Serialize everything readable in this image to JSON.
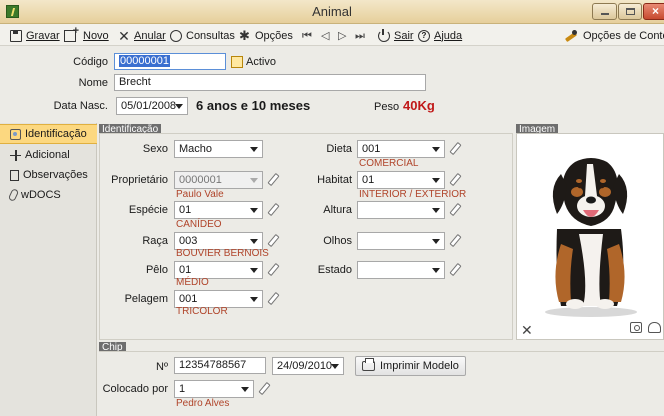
{
  "window": {
    "title": "Animal"
  },
  "toolbar": {
    "save": "Gravar",
    "new": "Novo",
    "cancel": "Anular",
    "queries": "Consultas",
    "options": "Opções",
    "exit": "Sair",
    "help": "Ajuda",
    "context_options": "Opções de Contexto",
    "nav_glyphs": {
      "first": "⏮",
      "prev": "◁",
      "next": "▷",
      "last": "⏭"
    }
  },
  "header": {
    "code_label": "Código",
    "code_value": "00000001",
    "active_label": "Activo",
    "name_label": "Nome",
    "name_value": "Brecht",
    "birth_label": "Data Nasc.",
    "birth_value": "05/01/2008",
    "age_text": "6 anos e 10 meses",
    "weight_label": "Peso",
    "weight_value": "40Kg",
    "weight_color": "#c01818"
  },
  "sidebar": {
    "items": [
      {
        "label": "Identificação",
        "icon": "id-card-icon",
        "active": true
      },
      {
        "label": "Adicional",
        "icon": "plus-icon",
        "active": false
      },
      {
        "label": "Observações",
        "icon": "document-icon",
        "active": false
      },
      {
        "label": "wDOCS",
        "icon": "paperclip-icon",
        "active": false
      }
    ]
  },
  "identification": {
    "title": "Identificação",
    "sexo": {
      "label": "Sexo",
      "value": "Macho"
    },
    "proprietario": {
      "label": "Proprietário",
      "value": "0000001",
      "desc": "Paulo Vale"
    },
    "especie": {
      "label": "Espécie",
      "value": "01",
      "desc": "CANÍDEO"
    },
    "raca": {
      "label": "Raça",
      "value": "003",
      "desc": "BOUVIER BERNOIS"
    },
    "pelo": {
      "label": "Pêlo",
      "value": "01",
      "desc": "MÉDIO"
    },
    "pelagem": {
      "label": "Pelagem",
      "value": "001",
      "desc": "TRICOLOR"
    },
    "dieta": {
      "label": "Dieta",
      "value": "001",
      "desc": "COMERCIAL"
    },
    "habitat": {
      "label": "Habitat",
      "value": "01",
      "desc": "INTERIOR / EXTERIOR"
    },
    "altura": {
      "label": "Altura",
      "value": ""
    },
    "olhos": {
      "label": "Olhos",
      "value": ""
    },
    "estado": {
      "label": "Estado",
      "value": ""
    },
    "desc_color": "#b0442a"
  },
  "image_panel": {
    "title": "Imagem"
  },
  "chip": {
    "title": "Chip",
    "number_label": "Nº",
    "number_value": "12354788567",
    "date_value": "24/09/2010",
    "print_button": "Imprimir Modelo",
    "placed_by_label": "Colocado por",
    "placed_by_value": "1",
    "placed_by_desc": "Pedro Alves"
  }
}
